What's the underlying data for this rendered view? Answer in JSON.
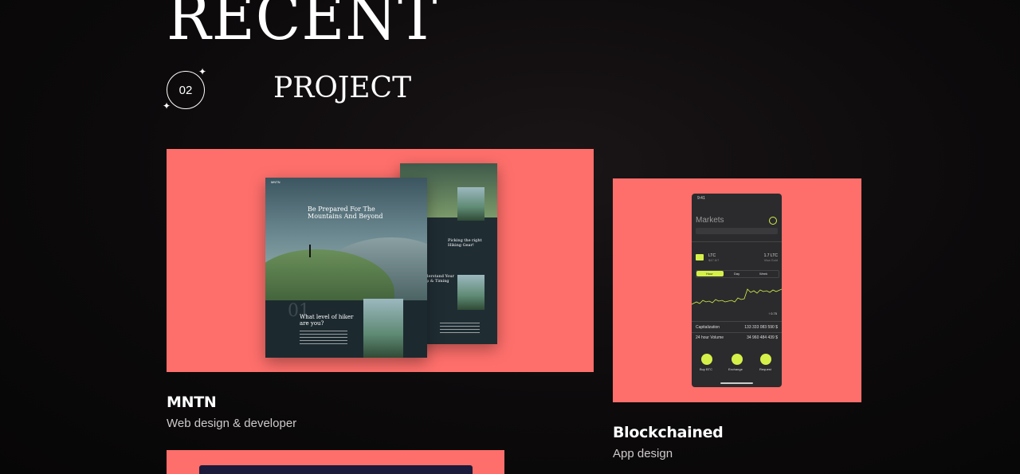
{
  "heading": {
    "line1": "RECENT",
    "number": "02",
    "line2": "PROJECT"
  },
  "projects": [
    {
      "title": "MNTN",
      "subtitle": "Web design & developer"
    },
    {
      "title": "Blockchained",
      "subtitle": "App design"
    }
  ],
  "mntn_mock": {
    "brand": "MNTN",
    "hero_line1": "Be Prepared For The",
    "hero_line2": "Mountains And Beyond",
    "section_num": "01",
    "section_title_line1": "What level of hiker",
    "section_title_line2": "are you?",
    "side_title_line1": "Picking the right",
    "side_title_line2": "Hiking Gear!",
    "side_title2_line1": "Understand Your",
    "side_title2_line2": "Map & Timing"
  },
  "phone_mock": {
    "time": "9:41",
    "header": "Markets",
    "coin": "LTC",
    "coin_price": "$47.6/7",
    "coin_amount": "1.7 LTC",
    "coin_note": "Visa Gold",
    "tabs": [
      "Hour",
      "Day",
      "Week"
    ],
    "change": "↑ 0.75",
    "rows": [
      {
        "label": "Capitalization",
        "value": "133 333 083 590 $"
      },
      {
        "label": "24 hour Volume",
        "value": "34 960 484 439 $"
      }
    ],
    "actions": [
      "Buy BTC",
      "Exchange",
      "Request"
    ],
    "accent": "#d6f04a"
  },
  "colors": {
    "card": "#fe6f6b",
    "background": "#0c0a0b"
  }
}
